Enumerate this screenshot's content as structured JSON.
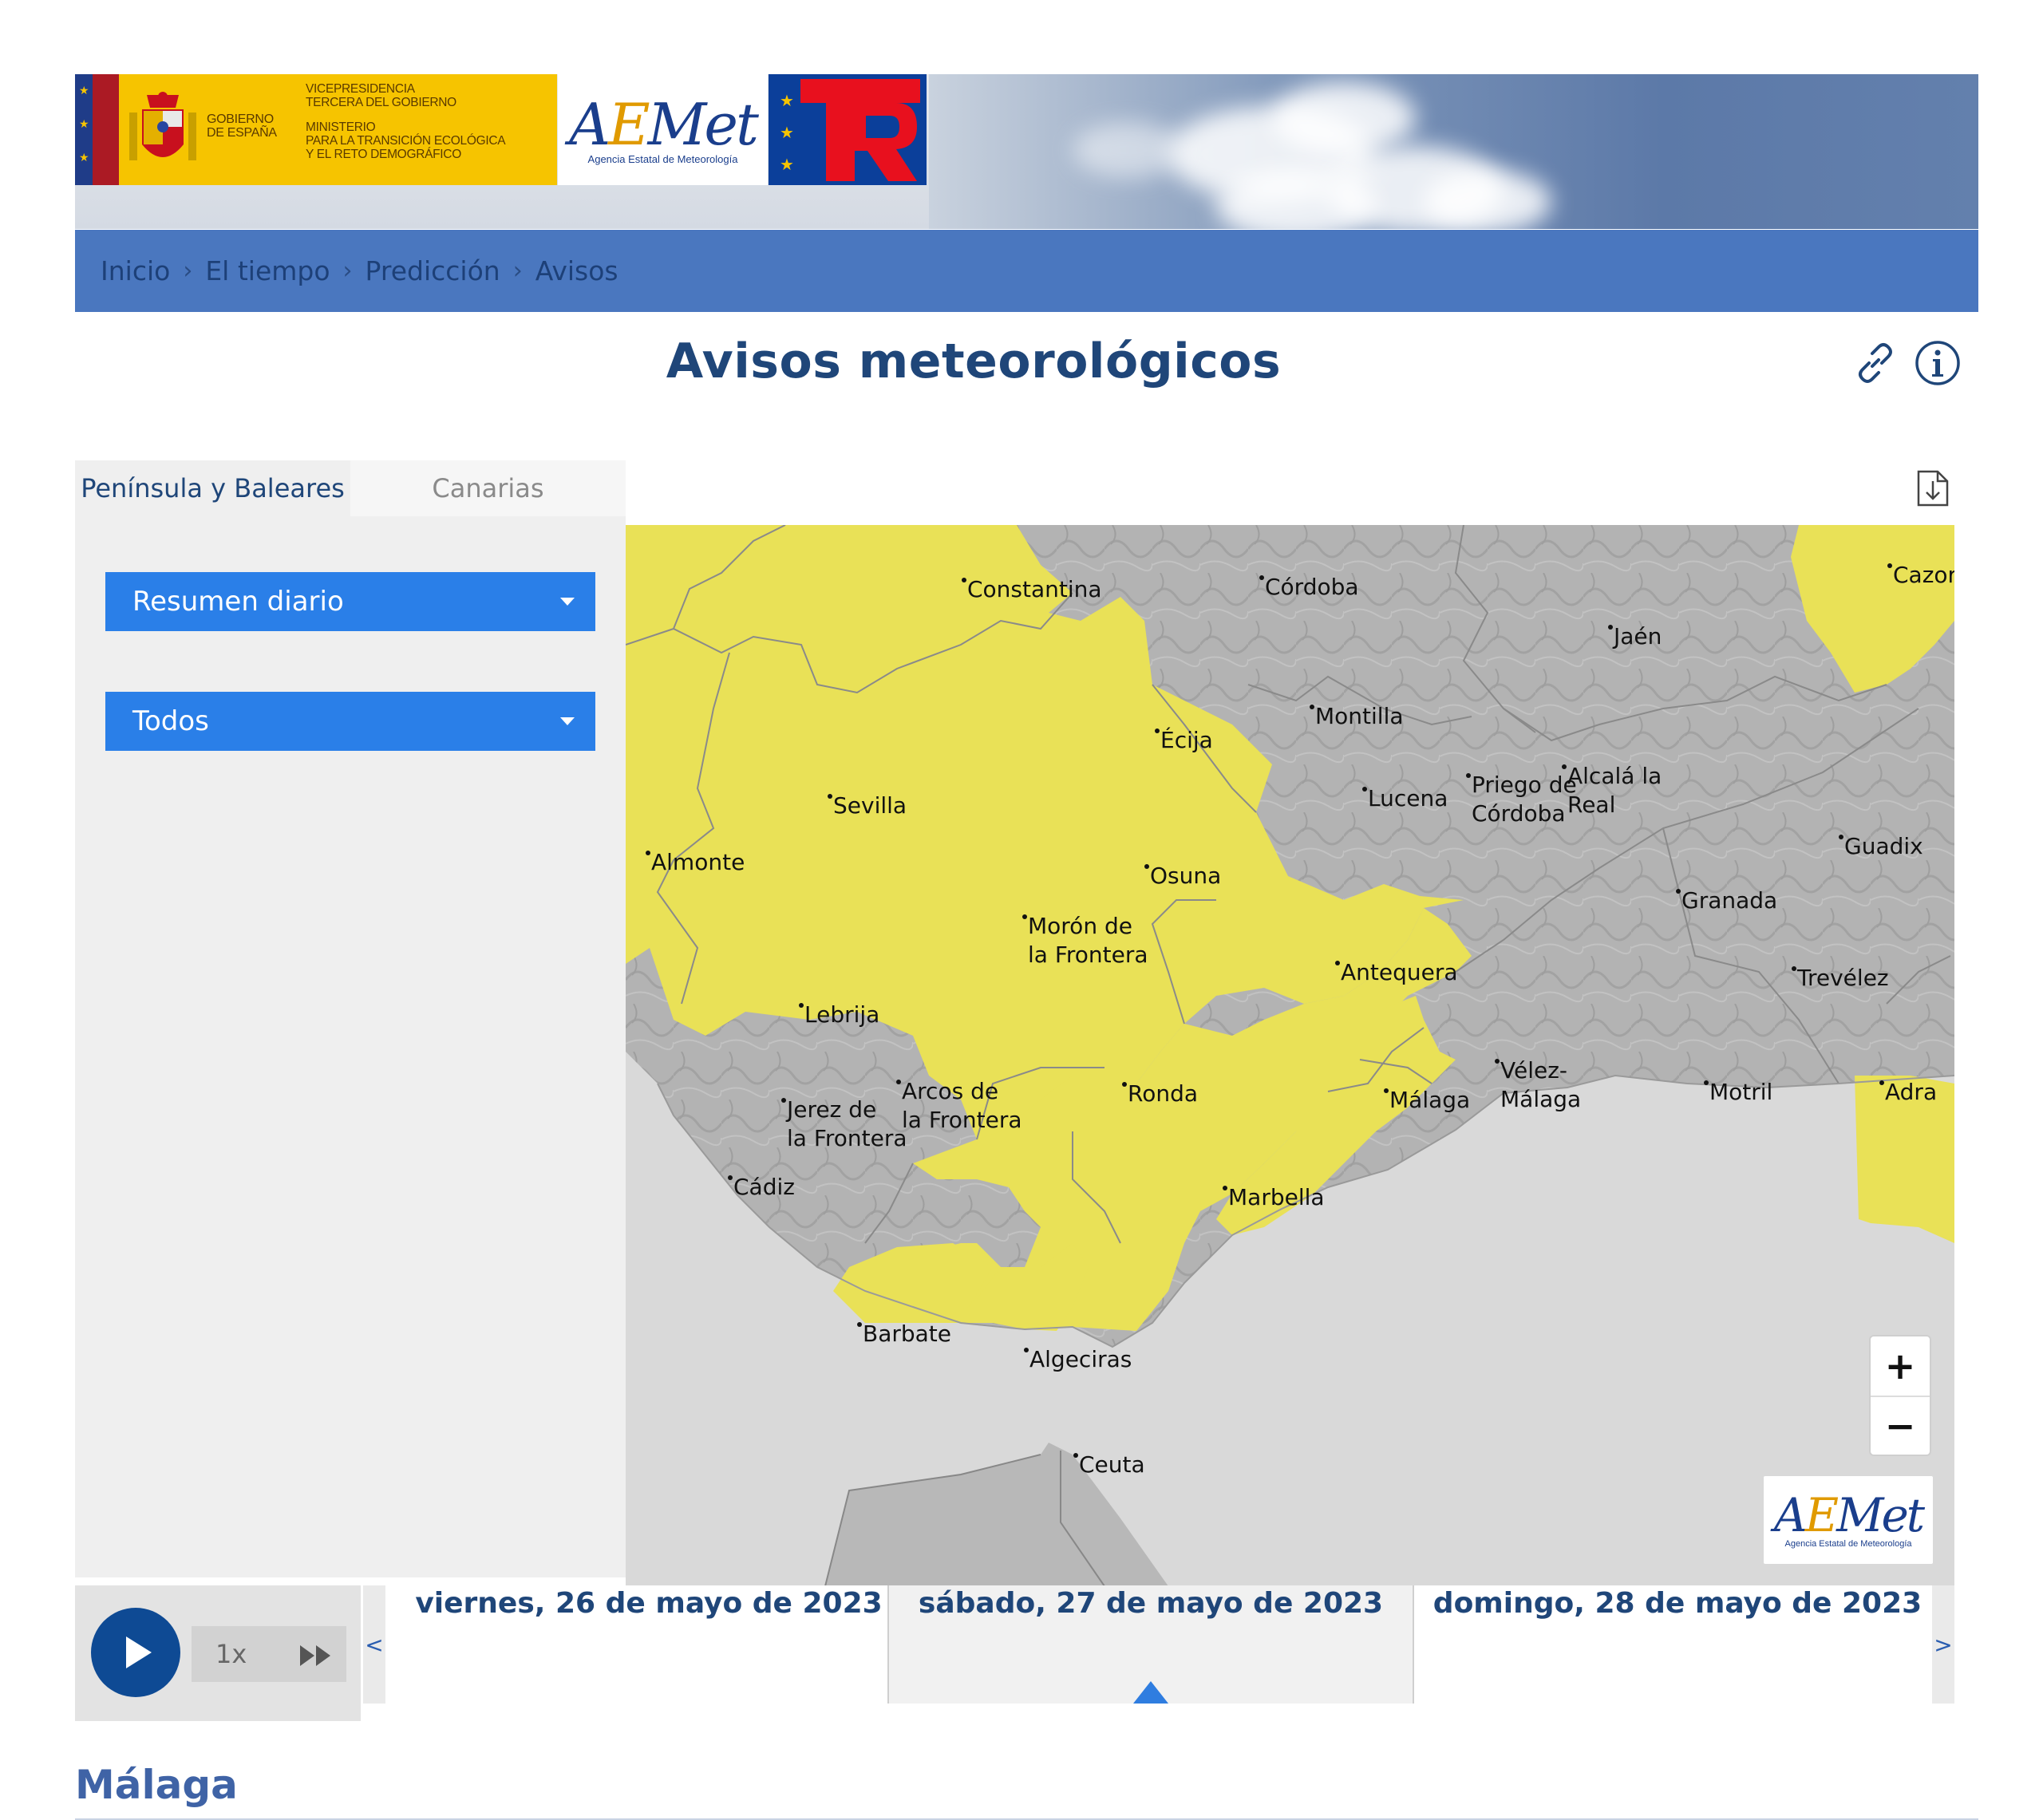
{
  "header": {
    "gov": {
      "line1": "GOBIERNO",
      "line2": "DE ESPAÑA",
      "vice1": "VICEPRESIDENCIA",
      "vice2": "TERCERA DEL GOBIERNO",
      "min1": "MINISTERIO",
      "min2": "PARA LA TRANSICIÓN ECOLÓGICA",
      "min3": "Y EL RETO DEMOGRÁFICO"
    },
    "aemet_logo": {
      "word_a": "A",
      "word_e": "E",
      "word_rest": "Met",
      "subtitle": "Agencia Estatal de Meteorología"
    },
    "prtr_logo": "PRTR"
  },
  "breadcrumb": [
    "Inicio",
    "El tiempo",
    "Predicción",
    "Avisos"
  ],
  "page": {
    "title": "Avisos meteorológicos"
  },
  "tabs": [
    {
      "label": "Península y Baleares",
      "active": true
    },
    {
      "label": "Canarias",
      "active": false
    }
  ],
  "selects": {
    "view": "Resumen diario",
    "type": "Todos"
  },
  "map": {
    "cities": {
      "constantina": "Constantina",
      "cordoba": "Córdoba",
      "cazorla": "Cazor",
      "jaen": "Jaén",
      "montilla": "Montilla",
      "ecija": "Écija",
      "sevilla": "Sevilla",
      "lucena": "Lucena",
      "priego1": "Priego de",
      "priego2": "Córdoba",
      "alcala1": "Alcalá la",
      "alcala2": "Real",
      "guadix": "Guadix",
      "almonte": "Almonte",
      "osuna": "Osuna",
      "granada": "Granada",
      "moron1": "Morón de",
      "moron2": "la Frontera",
      "antequera": "Antequera",
      "trevelez": "Trevélez",
      "lebrija": "Lebrija",
      "velez1": "Vélez-",
      "velez2": "Málaga",
      "arcos1": "Arcos de",
      "arcos2": "la Frontera",
      "jerez1": "Jerez de",
      "jerez2": "la Frontera",
      "ronda": "Ronda",
      "malaga": "Málaga",
      "motril": "Motril",
      "adra": "Adra",
      "cadiz": "Cádiz",
      "marbella": "Marbella",
      "barbate": "Barbate",
      "algeciras": "Algeciras",
      "ceuta": "Ceuta"
    },
    "zoom_in": "+",
    "zoom_out": "−",
    "colors": {
      "warning_yellow": "#e9e157",
      "land_gray": "#b5b5b5",
      "sea": "#d9d9d9"
    }
  },
  "player": {
    "speed": "1x"
  },
  "timeline": {
    "prev": "<",
    "next": ">",
    "days": [
      "viernes, 26 de mayo de 2023",
      "sábado, 27 de mayo de 2023",
      "domingo, 28 de mayo de 2023"
    ],
    "selected_index": 1
  },
  "region": {
    "title": "Málaga"
  }
}
